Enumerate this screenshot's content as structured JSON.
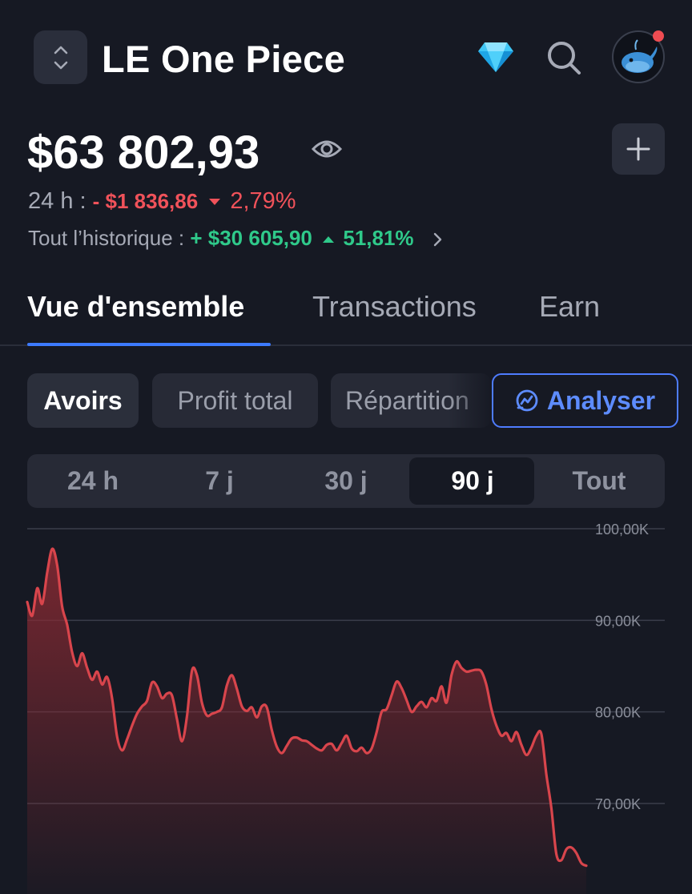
{
  "header": {
    "wallet_name": "LE One Piece",
    "icons": [
      "chevron-up-down-icon",
      "diamond-icon",
      "search-icon",
      "whale-avatar",
      "plus-icon",
      "eye-icon"
    ]
  },
  "balance": {
    "total": "$63 802,93",
    "day_label": "24 h :",
    "day_change": "- $1 836,86",
    "day_pct": "2,79%",
    "hist_label": "Tout l’historique :",
    "hist_change": "+ $30 605,90",
    "hist_pct": "51,81%"
  },
  "tabs": [
    {
      "label": "Vue d'ensemble",
      "active": true
    },
    {
      "label": "Transactions",
      "active": false
    },
    {
      "label": "Earn",
      "active": false
    }
  ],
  "chips": {
    "holdings": "Avoirs",
    "profit": "Profit total",
    "allocation": "Répartition",
    "analyze": "Analyser"
  },
  "periods": [
    {
      "label": "24 h",
      "active": false
    },
    {
      "label": "7 j",
      "active": false
    },
    {
      "label": "30 j",
      "active": false
    },
    {
      "label": "90 j",
      "active": true
    },
    {
      "label": "Tout",
      "active": false
    }
  ],
  "colors": {
    "background": "#161923",
    "accent": "#3d7bff",
    "negative": "#f0525a",
    "positive": "#2fc98a",
    "line": "#d8454c"
  },
  "chart_data": {
    "type": "area",
    "title": "",
    "xlabel": "",
    "ylabel": "",
    "ylim": [
      61,
      100
    ],
    "y_ticks": [
      "100,00K",
      "90,00K",
      "80,00K",
      "70,00K"
    ],
    "y_tick_values": [
      100,
      90,
      80,
      70
    ],
    "grid": true,
    "values": [
      92.0,
      90.5,
      93.5,
      91.8,
      95.2,
      97.8,
      96.0,
      91.5,
      89.5,
      86.5,
      85.0,
      86.4,
      84.8,
      83.5,
      84.4,
      83.0,
      83.8,
      81.5,
      77.3,
      75.8,
      77.0,
      78.5,
      79.8,
      80.6,
      81.2,
      83.2,
      82.8,
      81.5,
      82.0,
      81.8,
      79.2,
      76.8,
      79.5,
      84.5,
      84.0,
      81.0,
      79.6,
      79.8,
      80.0,
      80.5,
      82.9,
      84.0,
      82.5,
      80.6,
      80.1,
      80.5,
      79.4,
      80.6,
      80.5,
      78.0,
      76.2,
      75.5,
      76.3,
      77.1,
      77.2,
      76.9,
      76.8,
      76.4,
      76.0,
      75.8,
      76.4,
      76.5,
      75.8,
      76.6,
      77.4,
      76.0,
      75.7,
      76.1,
      75.5,
      76.0,
      77.8,
      80.0,
      80.3,
      81.8,
      83.3,
      82.6,
      81.3,
      80.0,
      80.6,
      81.1,
      80.5,
      81.5,
      81.2,
      82.8,
      81.0,
      84.0,
      85.5,
      84.8,
      84.4,
      84.5,
      84.6,
      84.4,
      82.9,
      80.3,
      78.5,
      77.4,
      77.7,
      76.8,
      77.8,
      76.4,
      75.3,
      76.1,
      77.4,
      77.6,
      73.2,
      69.5,
      64.5,
      63.8,
      65.0,
      65.2,
      64.6,
      63.5,
      63.2
    ]
  }
}
